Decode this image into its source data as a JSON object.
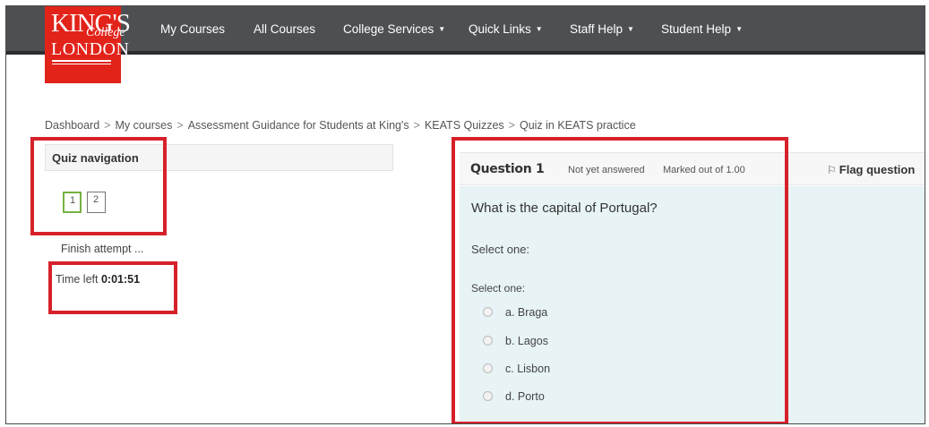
{
  "logo": {
    "line1": "KING'S",
    "line2": "College",
    "line3": "LONDON"
  },
  "nav": [
    {
      "label": "My Courses",
      "dropdown": false
    },
    {
      "label": "All Courses",
      "dropdown": false
    },
    {
      "label": "College Services",
      "dropdown": true
    },
    {
      "label": "Quick Links",
      "dropdown": true
    },
    {
      "label": "Staff Help",
      "dropdown": true
    },
    {
      "label": "Student Help",
      "dropdown": true
    }
  ],
  "breadcrumb": [
    "Dashboard",
    "My courses",
    "Assessment Guidance for Students at King's",
    "KEATS Quizzes",
    "Quiz in KEATS practice"
  ],
  "quiz_navigation": {
    "title": "Quiz navigation",
    "questions": [
      "1",
      "2"
    ],
    "finish_label": "Finish attempt ...",
    "time_left_label": "Time left",
    "time_left_value": "0:01:51"
  },
  "question": {
    "title": "Question 1",
    "status": "Not yet answered",
    "marks": "Marked out of 1.00",
    "flag_label": "Flag question",
    "text": "What is the capital of Portugal?",
    "select_prompt_1": "Select one:",
    "select_prompt_2": "Select one:",
    "options": [
      "a. Braga",
      "b. Lagos",
      "c. Lisbon",
      "d. Porto"
    ]
  },
  "colors": {
    "navbar": "#4d4f53",
    "logo_red": "#e2231a",
    "highlight_red": "#d6212a",
    "question_bg": "#e7f3f5",
    "current_question_border": "#75b143"
  }
}
